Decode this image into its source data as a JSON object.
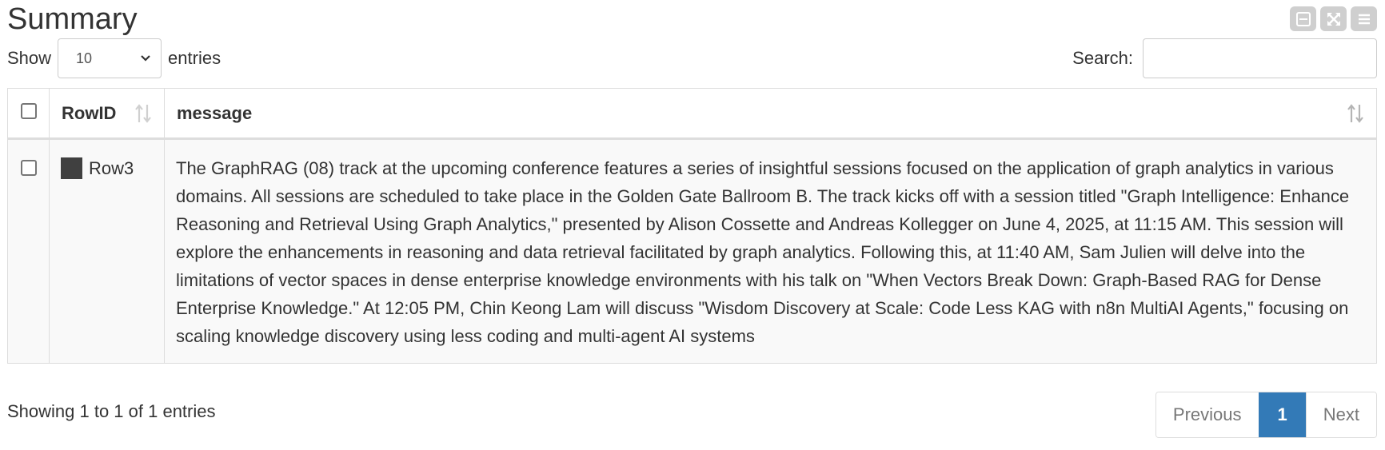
{
  "title": "Summary",
  "toolbar": {
    "icons": [
      "minimize-icon",
      "expand-icon",
      "menu-icon"
    ]
  },
  "length_control": {
    "show_label": "Show",
    "selected": "10",
    "entries_label": "entries"
  },
  "search": {
    "label": "Search:",
    "value": ""
  },
  "table": {
    "columns": [
      {
        "label": ""
      },
      {
        "label": "RowID"
      },
      {
        "label": "message"
      }
    ],
    "rows": [
      {
        "checked": false,
        "swatch_color": "#404040",
        "rowid": "Row3",
        "message": "The GraphRAG (08) track at the upcoming conference features a series of insightful sessions focused on the application of graph analytics in various domains. All sessions are scheduled to take place in the Golden Gate Ballroom B. The track kicks off with a session titled \"Graph Intelligence: Enhance Reasoning and Retrieval Using Graph Analytics,\" presented by Alison Cossette and Andreas Kollegger on June 4, 2025, at 11:15 AM. This session will explore the enhancements in reasoning and data retrieval facilitated by graph analytics. Following this, at 11:40 AM, Sam Julien will delve into the limitations of vector spaces in dense enterprise knowledge environments with his talk on \"When Vectors Break Down: Graph-Based RAG for Dense Enterprise Knowledge.\" At 12:05 PM, Chin Keong Lam will discuss \"Wisdom Discovery at Scale: Code Less KAG with n8n MultiAI Agents,\" focusing on scaling knowledge discovery using less coding and multi-agent AI systems"
      }
    ]
  },
  "info": "Showing 1 to 1 of 1 entries",
  "pagination": {
    "previous": "Previous",
    "current": "1",
    "next": "Next"
  },
  "colors": {
    "accent": "#337ab7",
    "row_bg": "#f9f9f9",
    "border": "#dddddd"
  }
}
